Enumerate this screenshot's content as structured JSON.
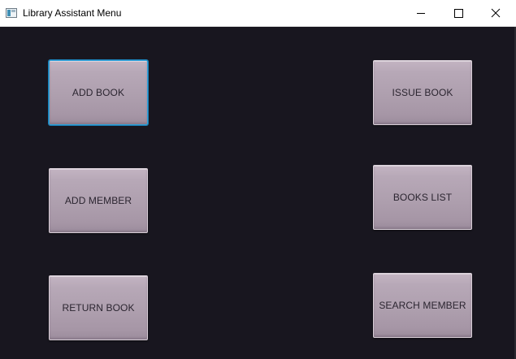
{
  "window": {
    "title": "Library Assistant Menu"
  },
  "controls": {
    "minimize": "minimize-icon",
    "maximize": "maximize-icon",
    "close": "close-icon"
  },
  "menu": {
    "add_book": "ADD BOOK",
    "add_member": "ADD MEMBER",
    "return_book": "RETURN BOOK",
    "issue_book": "ISSUE BOOK",
    "books_list": "BOOKS LIST",
    "search_member": "SEARCH MEMBER"
  },
  "colors": {
    "background": "#18161f",
    "button": "#b2a3b2",
    "focus_ring": "#2fa0d8",
    "titlebar": "#ffffff"
  }
}
